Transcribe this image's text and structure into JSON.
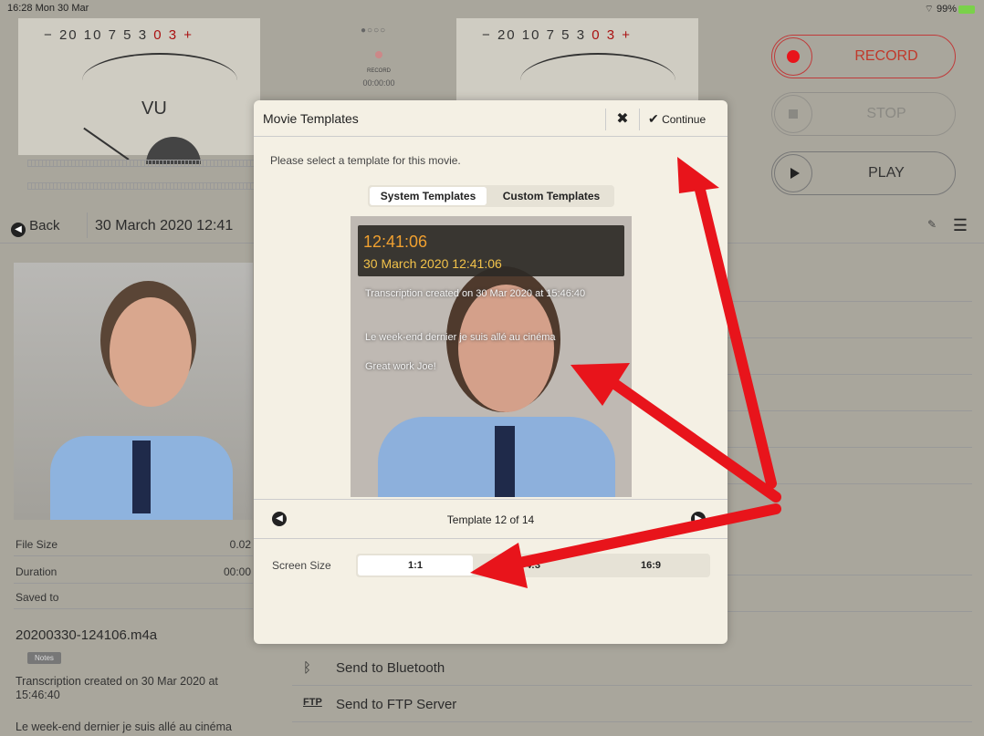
{
  "status": {
    "time": "16:28",
    "date": "Mon 30 Mar",
    "battery": "99%"
  },
  "meters": {
    "scale": [
      "20",
      "10",
      "7",
      "5",
      "3",
      "0",
      "3"
    ],
    "minus": "−",
    "plus": "+",
    "label": "VU"
  },
  "recorder": {
    "record_label": "RECORD",
    "time": "00:00:00",
    "record": "RECORD",
    "stop": "STOP",
    "play": "PLAY",
    "page_dots": "●○○○"
  },
  "nav": {
    "back": "Back",
    "title": "30 March 2020 12:41"
  },
  "info": {
    "rows": [
      {
        "key": "File Size",
        "value": "0.02"
      },
      {
        "key": "Duration",
        "value": "00:00"
      },
      {
        "key": "Saved to",
        "value": ""
      }
    ],
    "filename": "20200330-124106.m4a",
    "notes_badge": "Notes",
    "notes_line1": "Transcription created on 30 Mar 2020 at 15:46:40",
    "notes_line2": "Le week-end dernier je suis allé au cinéma"
  },
  "send": [
    {
      "icon": "bluetooth-icon",
      "label": "Send to Bluetooth"
    },
    {
      "icon": "ftp-icon",
      "label": "Send to FTP Server"
    }
  ],
  "modal": {
    "title": "Movie Templates",
    "close": "✖",
    "continue": "Continue",
    "prompt": "Please select a template for this movie.",
    "tabs": [
      "System Templates",
      "Custom Templates"
    ],
    "preview": {
      "time": "12:41:06",
      "date": "30 March 2020 12:41:06",
      "line1": "Transcription created on 30 Mar 2020 at 15:46:40",
      "line2": "Le week-end dernier je suis allé au cinéma",
      "line3": "Great work Joe!"
    },
    "template_label": "Template 12 of 14",
    "screen_size_label": "Screen Size",
    "sizes": [
      "1:1",
      "4:3",
      "16:9"
    ],
    "selected_size": "1:1"
  },
  "colors": {
    "accent_red": "#e8141b",
    "modal_bg": "#f4f0e4",
    "app_bg": "#a9a69c"
  }
}
